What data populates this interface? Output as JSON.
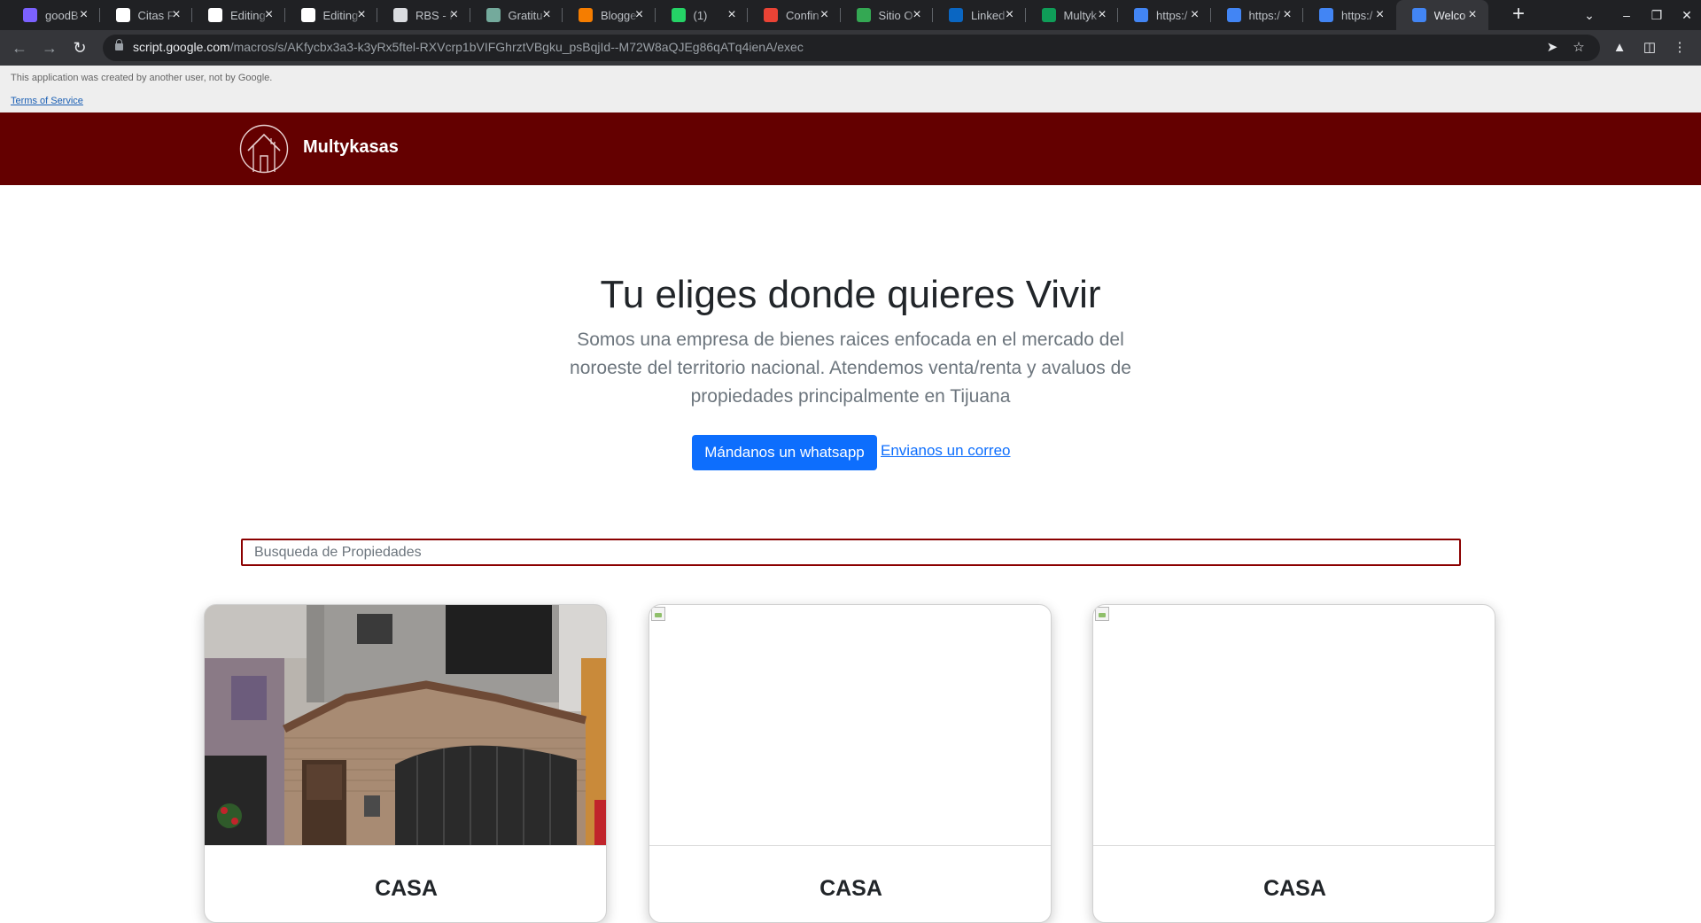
{
  "browser": {
    "tabs": [
      {
        "title": "goodB",
        "icon": "figma-icon",
        "color": "#7b61ff"
      },
      {
        "title": "Citas F",
        "icon": "notion-icon",
        "color": "#ffffff"
      },
      {
        "title": "Editing",
        "icon": "github-icon",
        "color": "#ffffff"
      },
      {
        "title": "Editing",
        "icon": "github-icon",
        "color": "#ffffff"
      },
      {
        "title": "RBS - I",
        "icon": "globe-icon",
        "color": "#dadce0"
      },
      {
        "title": "Gratitu",
        "icon": "chatgpt-icon",
        "color": "#74aa9c"
      },
      {
        "title": "Blogge",
        "icon": "blogger-icon",
        "color": "#f57d00"
      },
      {
        "title": "(1)",
        "icon": "whatsapp-icon",
        "color": "#25d366"
      },
      {
        "title": "Confin",
        "icon": "gmail-icon",
        "color": "#ea4335"
      },
      {
        "title": "Sitio O",
        "icon": "site-icon",
        "color": "#34a853"
      },
      {
        "title": "Linked",
        "icon": "linkedin-icon",
        "color": "#0a66c2"
      },
      {
        "title": "Multyk",
        "icon": "sheets-icon",
        "color": "#0f9d58"
      },
      {
        "title": "https:/",
        "icon": "apps-script-icon",
        "color": "#4285f4"
      },
      {
        "title": "https:/",
        "icon": "apps-script-icon",
        "color": "#4285f4"
      },
      {
        "title": "https:/",
        "icon": "apps-script-icon",
        "color": "#4285f4"
      },
      {
        "title": "Welco",
        "icon": "apps-script-icon",
        "color": "#4285f4",
        "active": true
      }
    ],
    "url_host": "script.google.com",
    "url_path": "/macros/s/AKfycbx3a3-k3yRx5ftel-RXVcrp1bVIFGhrztVBgku_psBqjId--M72W8aQJEg86qATq4ienA/exec"
  },
  "banner": {
    "notice": "This application was created by another user, not by Google.",
    "terms": "Terms of Service"
  },
  "navbar": {
    "brand": "Multykasas"
  },
  "hero": {
    "title": "Tu eliges donde quieres Vivir",
    "lead": "Somos una empresa de bienes raices enfocada en el mercado del noroeste del territorio nacional. Atendemos venta/renta y avaluos de propiedades principalmente en Tijuana",
    "whatsapp_button": "Mándanos un whatsapp",
    "email_link": "Envianos un correo"
  },
  "search": {
    "placeholder": "Busqueda de Propiedades"
  },
  "colors": {
    "brand": "#640000",
    "primary": "#0d6efd",
    "search_border": "#8b0000"
  },
  "listings": [
    {
      "type": "CASA",
      "has_photo": true
    },
    {
      "type": "CASA",
      "has_photo": false
    },
    {
      "type": "CASA",
      "has_photo": false
    }
  ]
}
